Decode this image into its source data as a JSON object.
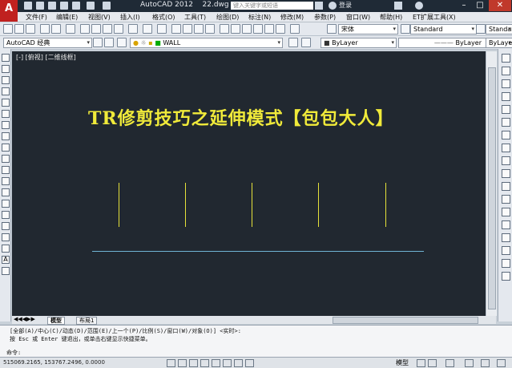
{
  "app": {
    "title": "AutoCAD 2012",
    "file": "22.dwg",
    "search_placeholder": "键入关键字或短语",
    "login": "登录"
  },
  "menu": [
    "文件(F)",
    "编辑(E)",
    "视图(V)",
    "插入(I)",
    "格式(O)",
    "工具(T)",
    "绘图(D)",
    "标注(N)",
    "修改(M)",
    "参数(P)",
    "窗口(W)",
    "帮助(H)",
    "ET扩展工具(X)"
  ],
  "toolbar2": {
    "font": "宋体",
    "style1": "Standard",
    "style2": "Standard"
  },
  "toolbar3": {
    "workspace": "AutoCAD 经典",
    "layer": "WALL",
    "color": "ByLayer",
    "linetype": "ByLayer",
    "lineweight": "ByLayer"
  },
  "viewport": {
    "label": "[-] [俯视] [二维线框]",
    "title_text": "TR修剪技巧之延伸模式【包包大人】"
  },
  "layout_tabs": [
    "模型",
    "布局1"
  ],
  "command": {
    "line1": "[全部(A)/中心(C)/动态(D)/范围(E)/上一个(P)/比例(S)/窗口(W)/对象(O)] <实时>:",
    "line2": "按 Esc 或 Enter 键退出，或单击右键显示快捷菜单。",
    "prompt": "命令:"
  },
  "status": {
    "coordinates": "515069.2165, 153767.2496, 0.0000",
    "model": "模型"
  },
  "colors": {
    "canvas": "#212830",
    "text_yellow": "#f0ea3a",
    "line_cyan": "#6fb4d4"
  }
}
